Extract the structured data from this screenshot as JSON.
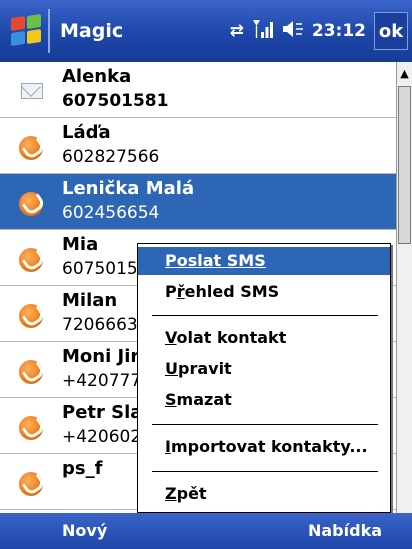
{
  "titlebar": {
    "title": "Magic",
    "time": "23:12",
    "ok_label": "ok",
    "icons": [
      "windows-start-icon",
      "connectivity-icon",
      "signal-icon",
      "volume-icon"
    ]
  },
  "contacts": [
    {
      "name": "Alenka",
      "number": "607501581",
      "icon": "mail-icon"
    },
    {
      "name": "Láďa",
      "number": "602827566",
      "icon": "phone-icon"
    },
    {
      "name": "Lenička Malá",
      "number": "602456654",
      "icon": "phone-icon"
    },
    {
      "name": "Mia",
      "number": "6075015",
      "icon": "phone-icon"
    },
    {
      "name": "Milan",
      "number": "7206663",
      "icon": "phone-icon"
    },
    {
      "name": "Moni Jir",
      "number": "+420777",
      "icon": "phone-icon"
    },
    {
      "name": "Petr Sla",
      "number": "+420602",
      "icon": "phone-icon"
    },
    {
      "name": "ps_f",
      "number": "",
      "icon": "phone-icon"
    }
  ],
  "menu": {
    "send_sms": {
      "underline": "P",
      "rest": "oslat SMS"
    },
    "sms_overview": {
      "pre": "P",
      "underline": "ř",
      "rest": "ehled SMS"
    },
    "call_contact": {
      "underline": "V",
      "rest": "olat kontakt"
    },
    "edit": {
      "underline": "U",
      "rest": "pravit"
    },
    "delete": {
      "underline": "S",
      "rest": "mazat"
    },
    "import_contacts": {
      "underline": "I",
      "rest": "mportovat kontakty..."
    },
    "back": {
      "underline": "Z",
      "rest": "pět"
    }
  },
  "softkeys": {
    "left": "Nový",
    "right": "Nabídka"
  },
  "colors": {
    "titlebar": "#1e47ab",
    "selection": "#2e66b6"
  }
}
